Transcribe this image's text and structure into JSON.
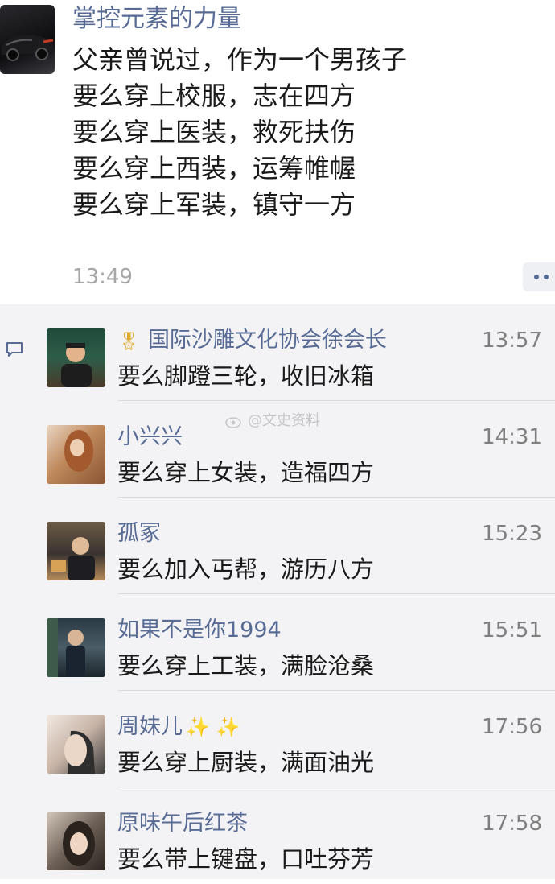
{
  "post": {
    "author": "掌控元素的力量",
    "lines": [
      "父亲曾说过，作为一个男孩子",
      "要么穿上校服，志在四方",
      "要么穿上医装，救死扶伤",
      "要么穿上西装，运筹帷幄",
      "要么穿上军装，镇守一方"
    ],
    "time": "13:49"
  },
  "watermark": "@文史资料",
  "comments": [
    {
      "name": "国际沙雕文化协会徐会长",
      "time": "13:57",
      "text": "要么脚蹬三轮，收旧冰箱",
      "badge": "medal-icon"
    },
    {
      "name": "小兴兴",
      "time": "14:31",
      "text": "要么穿上女装，造福四方"
    },
    {
      "name": "孤冢",
      "time": "15:23",
      "text": "要么加入丐帮，游历八方"
    },
    {
      "name": "如果不是你1994",
      "time": "15:51",
      "text": "要么穿上工装，满脸沧桑"
    },
    {
      "name": "周妹儿",
      "time": "17:56",
      "text": "要么穿上厨装，满面油光",
      "suffix": "✨ ✨"
    },
    {
      "name": "原味午后红茶",
      "time": "17:58",
      "text": "要么带上键盘，口吐芬芳"
    }
  ],
  "colors": {
    "name_link": "#576b95",
    "comment_bg": "#f3f3f5",
    "time_gray": "#7f7f7f"
  }
}
